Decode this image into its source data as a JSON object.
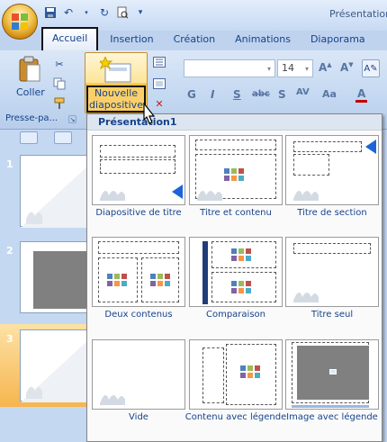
{
  "window": {
    "title": "Présentation"
  },
  "qat": {
    "icons": [
      "save-icon",
      "undo-icon",
      "redo-icon",
      "print-preview-icon",
      "customize-icon"
    ]
  },
  "tabs": [
    {
      "label": "Accueil",
      "active": true
    },
    {
      "label": "Insertion"
    },
    {
      "label": "Création"
    },
    {
      "label": "Animations"
    },
    {
      "label": "Diaporama"
    }
  ],
  "ribbon": {
    "coller_label": "Coller",
    "clipboard_group_label": "Presse-pa...",
    "new_slide_label": "Nouvelle diapositive",
    "font_size_value": "14"
  },
  "dropdown": {
    "header": "Présentation1",
    "layouts": [
      {
        "label": "Diapositive de titre"
      },
      {
        "label": "Titre et contenu"
      },
      {
        "label": "Titre de section"
      },
      {
        "label": "Deux contenus"
      },
      {
        "label": "Comparaison"
      },
      {
        "label": "Titre seul"
      },
      {
        "label": "Vide"
      },
      {
        "label": "Contenu avec légende"
      },
      {
        "label": "Image avec légende"
      }
    ]
  },
  "slides": [
    {
      "number": "1"
    },
    {
      "number": "2"
    },
    {
      "number": "3",
      "selected": true
    }
  ],
  "colors": {
    "accent_blue": "#15428b",
    "selection_orange": "#f6b54e",
    "ribbon_bg": "#c4d8f1"
  }
}
